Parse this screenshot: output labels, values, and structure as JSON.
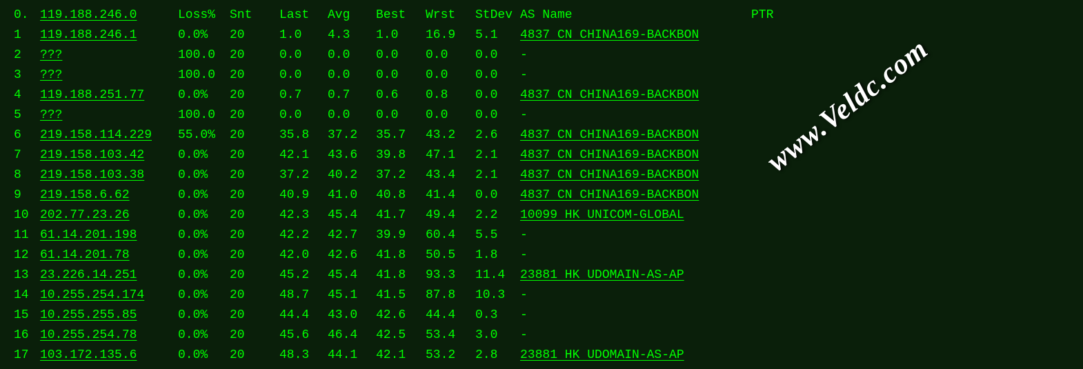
{
  "watermark": "www.Veldc.com",
  "headers": {
    "hop": "0.",
    "ip": "119.188.246.0",
    "loss": "Loss%",
    "snt": "Snt",
    "last": "Last",
    "avg": "Avg",
    "best": "Best",
    "wrst": "Wrst",
    "stdev": "StDev",
    "asname": "AS Name",
    "ptr": "PTR"
  },
  "rows": [
    {
      "hop": "1",
      "ip": "119.188.246.1",
      "loss": "0.0%",
      "snt": "20",
      "last": "1.0",
      "avg": "4.3",
      "best": "1.0",
      "wrst": "16.9",
      "stdev": "5.1",
      "asname": "4837  CN CHINA169-BACKBON",
      "as_underline": true
    },
    {
      "hop": "2",
      "ip": "???",
      "loss": "100.0",
      "snt": "20",
      "last": "0.0",
      "avg": "0.0",
      "best": "0.0",
      "wrst": "0.0",
      "stdev": "0.0",
      "asname": "-",
      "as_underline": false
    },
    {
      "hop": "3",
      "ip": "???",
      "loss": "100.0",
      "snt": "20",
      "last": "0.0",
      "avg": "0.0",
      "best": "0.0",
      "wrst": "0.0",
      "stdev": "0.0",
      "asname": "-",
      "as_underline": false
    },
    {
      "hop": "4",
      "ip": "119.188.251.77",
      "loss": "0.0%",
      "snt": "20",
      "last": "0.7",
      "avg": "0.7",
      "best": "0.6",
      "wrst": "0.8",
      "stdev": "0.0",
      "asname": "4837  CN CHINA169-BACKBON",
      "as_underline": true
    },
    {
      "hop": "5",
      "ip": "???",
      "loss": "100.0",
      "snt": "20",
      "last": "0.0",
      "avg": "0.0",
      "best": "0.0",
      "wrst": "0.0",
      "stdev": "0.0",
      "asname": "-",
      "as_underline": false
    },
    {
      "hop": "6",
      "ip": "219.158.114.229",
      "loss": "55.0%",
      "snt": "20",
      "last": "35.8",
      "avg": "37.2",
      "best": "35.7",
      "wrst": "43.2",
      "stdev": "2.6",
      "asname": "4837  CN CHINA169-BACKBON",
      "as_underline": true
    },
    {
      "hop": "7",
      "ip": "219.158.103.42",
      "loss": "0.0%",
      "snt": "20",
      "last": "42.1",
      "avg": "43.6",
      "best": "39.8",
      "wrst": "47.1",
      "stdev": "2.1",
      "asname": "4837  CN CHINA169-BACKBON",
      "as_underline": true
    },
    {
      "hop": "8",
      "ip": "219.158.103.38",
      "loss": "0.0%",
      "snt": "20",
      "last": "37.2",
      "avg": "40.2",
      "best": "37.2",
      "wrst": "43.4",
      "stdev": "2.1",
      "asname": "4837  CN CHINA169-BACKBON",
      "as_underline": true
    },
    {
      "hop": "9",
      "ip": "219.158.6.62",
      "loss": "0.0%",
      "snt": "20",
      "last": "40.9",
      "avg": "41.0",
      "best": "40.8",
      "wrst": "41.4",
      "stdev": "0.0",
      "asname": "4837  CN CHINA169-BACKBON",
      "as_underline": true
    },
    {
      "hop": "10",
      "ip": "202.77.23.26",
      "loss": "0.0%",
      "snt": "20",
      "last": "42.3",
      "avg": "45.4",
      "best": "41.7",
      "wrst": "49.4",
      "stdev": "2.2",
      "asname": "10099 HK UNICOM-GLOBAL",
      "as_underline": true
    },
    {
      "hop": "11",
      "ip": "61.14.201.198",
      "loss": "0.0%",
      "snt": "20",
      "last": "42.2",
      "avg": "42.7",
      "best": "39.9",
      "wrst": "60.4",
      "stdev": "5.5",
      "asname": "-",
      "as_underline": false
    },
    {
      "hop": "12",
      "ip": "61.14.201.78",
      "loss": "0.0%",
      "snt": "20",
      "last": "42.0",
      "avg": "42.6",
      "best": "41.8",
      "wrst": "50.5",
      "stdev": "1.8",
      "asname": "-",
      "as_underline": false
    },
    {
      "hop": "13",
      "ip": "23.226.14.251",
      "loss": "0.0%",
      "snt": "20",
      "last": "45.2",
      "avg": "45.4",
      "best": "41.8",
      "wrst": "93.3",
      "stdev": "11.4",
      "asname": "23881 HK UDOMAIN-AS-AP",
      "as_underline": true
    },
    {
      "hop": "14",
      "ip": "10.255.254.174",
      "loss": "0.0%",
      "snt": "20",
      "last": "48.7",
      "avg": "45.1",
      "best": "41.5",
      "wrst": "87.8",
      "stdev": "10.3",
      "asname": "-",
      "as_underline": false
    },
    {
      "hop": "15",
      "ip": "10.255.255.85",
      "loss": "0.0%",
      "snt": "20",
      "last": "44.4",
      "avg": "43.0",
      "best": "42.6",
      "wrst": "44.4",
      "stdev": "0.3",
      "asname": "-",
      "as_underline": false
    },
    {
      "hop": "16",
      "ip": "10.255.254.78",
      "loss": "0.0%",
      "snt": "20",
      "last": "45.6",
      "avg": "46.4",
      "best": "42.5",
      "wrst": "53.4",
      "stdev": "3.0",
      "asname": "-",
      "as_underline": false
    },
    {
      "hop": "17",
      "ip": "103.172.135.6",
      "loss": "0.0%",
      "snt": "20",
      "last": "48.3",
      "avg": "44.1",
      "best": "42.1",
      "wrst": "53.2",
      "stdev": "2.8",
      "asname": "23881 HK UDOMAIN-AS-AP",
      "as_underline": true
    }
  ]
}
